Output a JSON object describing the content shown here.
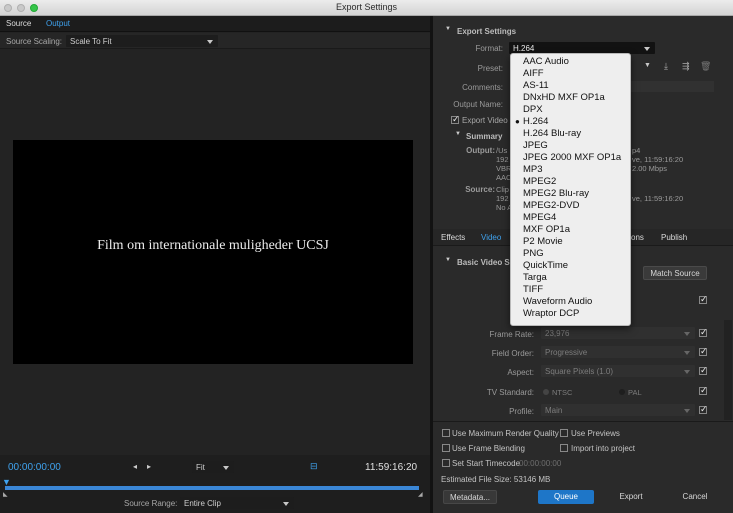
{
  "window": {
    "title": "Export Settings"
  },
  "colors": {
    "accent": "#3fa2ee",
    "queue_button": "#1e76c8",
    "menu_bg": "#eeeeee"
  },
  "left": {
    "tabs": [
      "Source",
      "Output"
    ],
    "scaling_label": "Source Scaling:",
    "scaling_value": "Scale To Fit",
    "video_caption": "Film om internationale muligheder UCSJ",
    "current_time": "00:00:00:00",
    "fit_value": "Fit",
    "duration": "11:59:16:20",
    "playhead_fraction": 0.0,
    "source_range_label": "Source Range:",
    "source_range_value": "Entire Clip"
  },
  "export_settings": {
    "title": "Export Settings",
    "format_label": "Format:",
    "format_value": "H.264",
    "preset_label": "Preset:",
    "comments_label": "Comments:",
    "output_name_label": "Output Name:",
    "export_video_label": "Export Video",
    "summary_title": "Summary",
    "output_label": "Output:",
    "output_lines": [
      "/Us",
      "192",
      "VBR",
      "AAC"
    ],
    "output_right_lines": [
      "p4",
      "ve, 11:59:16:20",
      "2.00 Mbps",
      ""
    ],
    "source_label": "Source:",
    "source_lines": [
      "Clip",
      "192",
      "No A"
    ],
    "source_right_lines": [
      "",
      "ve, 11:59:16:20",
      ""
    ]
  },
  "format_menu": {
    "selected": "H.264",
    "items": [
      "AAC Audio",
      "AIFF",
      "AS-11",
      "DNxHD MXF OP1a",
      "DPX",
      "H.264",
      "H.264 Blu-ray",
      "JPEG",
      "JPEG 2000 MXF OP1a",
      "MP3",
      "MPEG2",
      "MPEG2 Blu-ray",
      "MPEG2-DVD",
      "MPEG4",
      "MXF OP1a",
      "P2 Movie",
      "PNG",
      "QuickTime",
      "Targa",
      "TIFF",
      "Waveform Audio",
      "Wraptor DCP"
    ]
  },
  "video_tabs": [
    "Effects",
    "Video",
    "ons",
    "Publish"
  ],
  "video_settings": {
    "title": "Basic Video Se",
    "match_source": "Match Source",
    "frame_rate_label": "Frame Rate:",
    "frame_rate_value": "23,976",
    "field_order_label": "Field Order:",
    "field_order_value": "Progressive",
    "aspect_label": "Aspect:",
    "aspect_value": "Square Pixels (1.0)",
    "tv_standard_label": "TV Standard:",
    "tv_ntsc": "NTSC",
    "tv_pal": "PAL",
    "profile_label": "Profile:",
    "profile_value": "Main"
  },
  "bottom": {
    "max_render": "Use Maximum Render Quality",
    "use_previews": "Use Previews",
    "frame_blending": "Use Frame Blending",
    "import_project": "Import into project",
    "set_start": "Set Start Timecode",
    "start_tc": "00:00:00:00",
    "file_size": "Estimated File Size:  53146 MB",
    "metadata": "Metadata...",
    "queue": "Queue",
    "export": "Export",
    "cancel": "Cancel"
  }
}
